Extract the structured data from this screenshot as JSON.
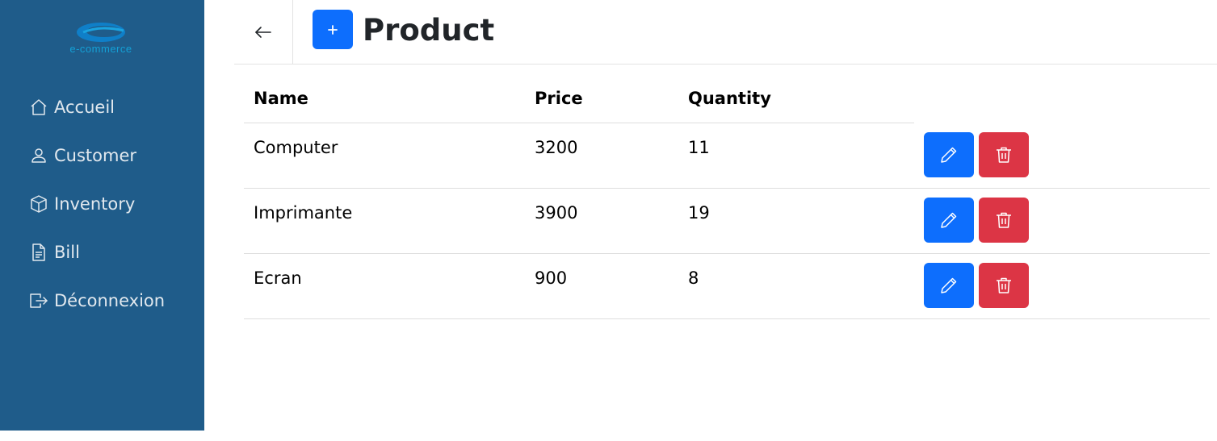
{
  "logo": {
    "text": "e-commerce"
  },
  "sidebar": {
    "items": [
      {
        "label": "Accueil",
        "icon": "house-icon"
      },
      {
        "label": "Customer",
        "icon": "person-icon"
      },
      {
        "label": "Inventory",
        "icon": "box-icon"
      },
      {
        "label": "Bill",
        "icon": "file-text-icon"
      },
      {
        "label": "Déconnexion",
        "icon": "logout-icon"
      }
    ]
  },
  "header": {
    "title": "Product",
    "back_icon": "arrow-left-icon",
    "add_icon": "plus-icon"
  },
  "table": {
    "columns": [
      "Name",
      "Price",
      "Quantity"
    ],
    "rows": [
      {
        "name": "Computer",
        "price": "3200",
        "quantity": "11"
      },
      {
        "name": "Imprimante",
        "price": "3900",
        "quantity": "19"
      },
      {
        "name": "Ecran",
        "price": "900",
        "quantity": "8"
      }
    ],
    "edit_icon": "pencil-icon",
    "delete_icon": "trash-icon"
  },
  "colors": {
    "sidebar": "#1f5c8a",
    "primary": "#0d6efd",
    "danger": "#dc3545",
    "title": "#212529"
  }
}
